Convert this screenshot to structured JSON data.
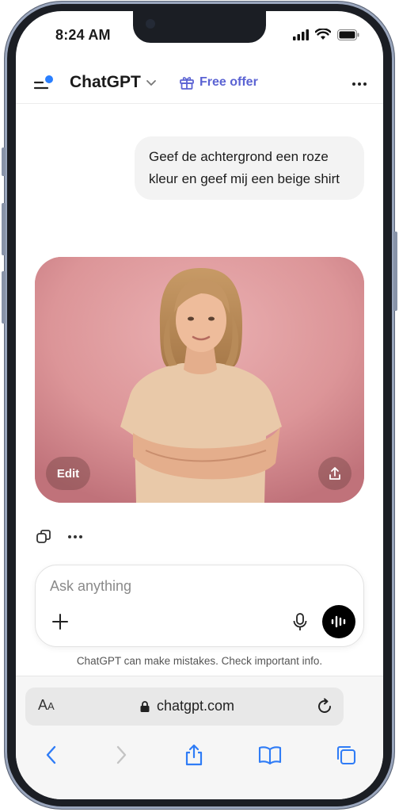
{
  "status": {
    "time": "8:24 AM"
  },
  "header": {
    "title": "ChatGPT",
    "free_offer_label": "Free offer"
  },
  "conversation": {
    "user_message": "Geef de achtergrond een roze kleur en geef mij een beige shirt",
    "image_actions": {
      "edit_label": "Edit"
    }
  },
  "composer": {
    "placeholder": "Ask anything"
  },
  "disclaimer": "ChatGPT can make mistakes. Check important info.",
  "browser": {
    "aa_big": "A",
    "aa_small": "A",
    "url": "chatgpt.com"
  },
  "colors": {
    "accent": "#5b63d3",
    "notification_dot": "#2a7fff",
    "image_background": "#dd9699",
    "shirt": "#e9c9a9",
    "safari_blue": "#2f7cf6"
  },
  "icons": [
    "sidebar-menu-icon",
    "chevron-down-icon",
    "gift-icon",
    "more-options-icon",
    "share-icon",
    "copy-icon",
    "plus-icon",
    "microphone-icon",
    "voice-mode-icon",
    "lock-icon",
    "reload-icon",
    "back-icon",
    "forward-icon",
    "share-icon",
    "bookmarks-icon",
    "tabs-icon"
  ]
}
